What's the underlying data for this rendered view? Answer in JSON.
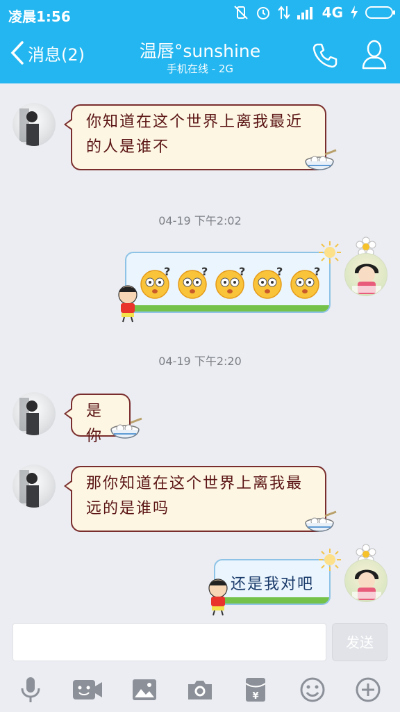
{
  "status_bar": {
    "time": "凌晨1:56",
    "network": "4G"
  },
  "nav": {
    "back_label": "消息(2)",
    "title": "温唇°sunshine",
    "subtitle": "手机在线 - 2G"
  },
  "messages": [
    {
      "from": "friend",
      "text_line1": "你知道在这个世界上离我最近",
      "text_line2": "的人是谁不"
    },
    {
      "time": "04-19 下午2:02"
    },
    {
      "from": "me",
      "content": "5 × question-face emoji",
      "emoji_count": 5
    },
    {
      "time": "04-19 下午2:20"
    },
    {
      "from": "friend",
      "text": "是你"
    },
    {
      "from": "friend",
      "text_line1": "那你知道在这个世界上离我最",
      "text_line2": "远的是谁吗"
    },
    {
      "from": "me",
      "text": "还是我对吧"
    }
  ],
  "input": {
    "placeholder": "",
    "send_label": "发送"
  },
  "toolbar": [
    "mic-icon",
    "video-icon",
    "image-icon",
    "camera-icon",
    "red-packet-icon",
    "emoji-icon",
    "plus-icon"
  ],
  "colors": {
    "accent": "#23b6f0",
    "friend_bubble_border": "#7a2d2d",
    "me_bubble_border": "#8ec3e6"
  }
}
